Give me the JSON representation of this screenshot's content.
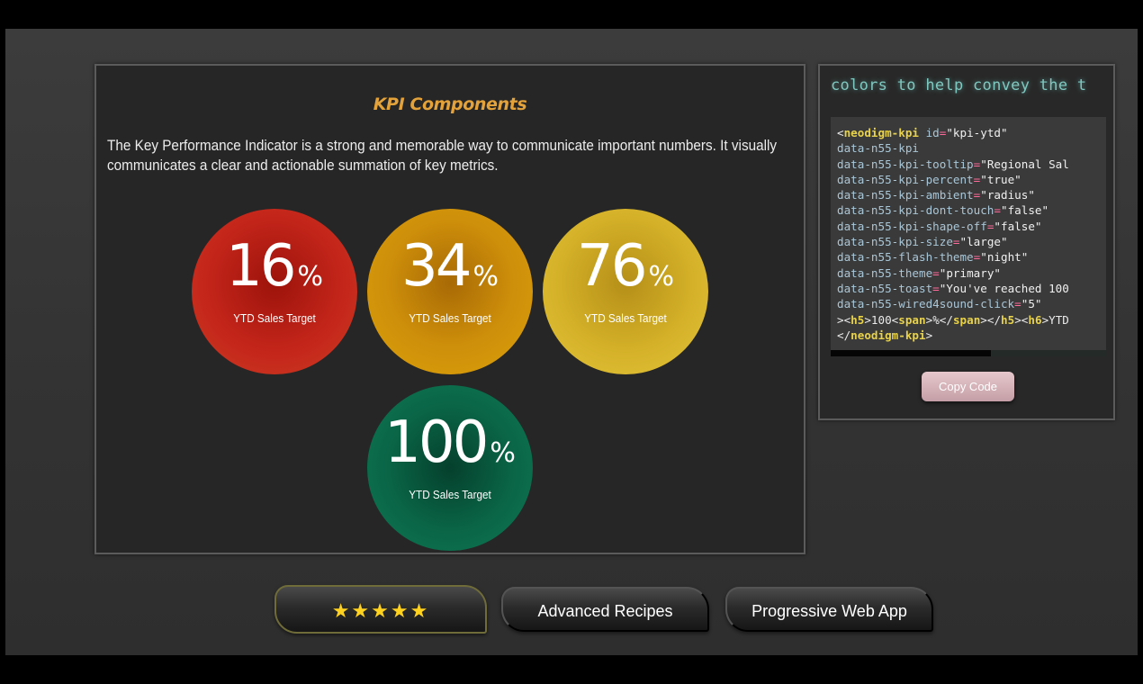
{
  "main": {
    "title": "KPI Components",
    "description": "The Key Performance Indicator is a strong and memorable way to communicate important numbers. It visually communicates a clear and actionable summation of key metrics.",
    "kpis": [
      {
        "value": "16",
        "unit": "%",
        "label": "YTD Sales Target",
        "color": "#c4251a"
      },
      {
        "value": "34",
        "unit": "%",
        "label": "YTD Sales Target",
        "color": "#cd8e0a"
      },
      {
        "value": "76",
        "unit": "%",
        "label": "YTD Sales Target",
        "color": "#d4b128"
      },
      {
        "value": "100",
        "unit": "%",
        "label": "YTD Sales Target",
        "color": "#0a6647"
      }
    ]
  },
  "code_panel": {
    "marquee_text": "colors to help convey the t",
    "code_lines": [
      [
        [
          "punc",
          "<"
        ],
        [
          "tag",
          "neodigm-kpi"
        ],
        [
          "attr",
          " id"
        ],
        [
          "eq",
          "="
        ],
        [
          "str",
          "\"kpi-ytd\""
        ]
      ],
      [
        [
          "attr",
          "data-n55-kpi"
        ]
      ],
      [
        [
          "attr",
          "data-n55-kpi-tooltip"
        ],
        [
          "eq",
          "="
        ],
        [
          "str",
          "\"Regional Sal"
        ]
      ],
      [
        [
          "attr",
          "data-n55-kpi-percent"
        ],
        [
          "eq",
          "="
        ],
        [
          "str",
          "\"true\""
        ]
      ],
      [
        [
          "attr",
          "data-n55-kpi-ambient"
        ],
        [
          "eq",
          "="
        ],
        [
          "str",
          "\"radius\""
        ]
      ],
      [
        [
          "attr",
          "data-n55-kpi-dont-touch"
        ],
        [
          "eq",
          "="
        ],
        [
          "str",
          "\"false\""
        ]
      ],
      [
        [
          "attr",
          "data-n55-kpi-shape-off"
        ],
        [
          "eq",
          "="
        ],
        [
          "str",
          "\"false\""
        ]
      ],
      [
        [
          "attr",
          "data-n55-kpi-size"
        ],
        [
          "eq",
          "="
        ],
        [
          "str",
          "\"large\""
        ]
      ],
      [
        [
          "attr",
          "data-n55-flash-theme"
        ],
        [
          "eq",
          "="
        ],
        [
          "str",
          "\"night\""
        ]
      ],
      [
        [
          "attr",
          "data-n55-theme"
        ],
        [
          "eq",
          "="
        ],
        [
          "str",
          "\"primary\""
        ]
      ],
      [
        [
          "attr",
          "data-n55-toast"
        ],
        [
          "eq",
          "="
        ],
        [
          "str",
          "\"You've reached 100"
        ]
      ],
      [
        [
          "attr",
          "data-n55-wired4sound-click"
        ],
        [
          "eq",
          "="
        ],
        [
          "str",
          "\"5\""
        ]
      ],
      [
        [
          "punc",
          "><"
        ],
        [
          "tag",
          "h5"
        ],
        [
          "punc",
          ">100<"
        ],
        [
          "tag",
          "span"
        ],
        [
          "punc",
          ">%</"
        ],
        [
          "tag",
          "span"
        ],
        [
          "punc",
          "></"
        ],
        [
          "tag",
          "h5"
        ],
        [
          "punc",
          "><"
        ],
        [
          "tag",
          "h6"
        ],
        [
          "punc",
          ">YTD"
        ]
      ],
      [
        [
          "punc",
          "</"
        ],
        [
          "tag",
          "neodigm-kpi"
        ],
        [
          "punc",
          ">"
        ]
      ]
    ],
    "copy_label": "Copy Code"
  },
  "footer": {
    "stars_label": "★★★★★",
    "advanced_label": "Advanced Recipes",
    "pwa_label": "Progressive Web App"
  }
}
